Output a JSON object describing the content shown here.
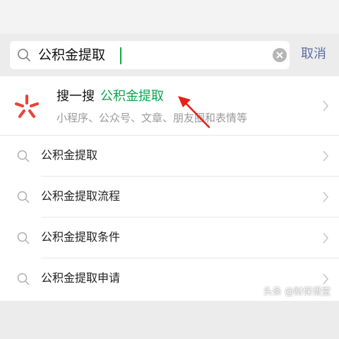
{
  "search": {
    "query": "公积金提取",
    "cancel_label": "取消"
  },
  "sousou": {
    "label": "搜一搜",
    "keyword": "公积金提取",
    "subtitle": "小程序、公众号、文章、朋友圈和表情等"
  },
  "suggestions": [
    {
      "label": "公积金提取"
    },
    {
      "label": "公积金提取流程"
    },
    {
      "label": "公积金提取条件"
    },
    {
      "label": "公积金提取申请"
    }
  ],
  "watermark": "头条 @财保语堂",
  "colors": {
    "accent_green": "#0aa64e",
    "cancel_blue": "#5a6ea3",
    "arrow_red": "#e8201a",
    "sousou_logo_red": "#e8453c"
  },
  "icons": {
    "search": "search-icon",
    "clear": "clear-icon",
    "chevron": "chevron-right-icon",
    "logo": "sousou-logo-icon"
  }
}
